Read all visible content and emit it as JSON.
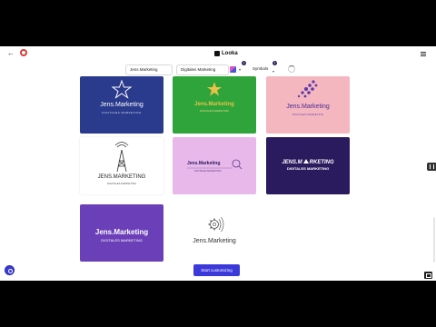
{
  "header": {
    "brand": "Looka",
    "back_icon": "back-arrow-icon",
    "notification_icon": "notification-icon",
    "menu_icon": "menu-icon"
  },
  "filters": {
    "company_name": "Jens.Marketing",
    "industry": "Digitales Marketing",
    "colors_badge": "1",
    "symbols_label": "Symbols",
    "symbols_badge": "1"
  },
  "logos": [
    {
      "name": "Jens.Marketing",
      "tagline": "DIGITALES MARKETING",
      "icon": "star-icon"
    },
    {
      "name": "Jens.Marketing",
      "tagline": "DIGITALES MARKETING",
      "icon": "star-icon"
    },
    {
      "name": "Jens.Marketing",
      "tagline": "DIGITALES MARKETING",
      "icon": "dots-icon"
    },
    {
      "name": "JENS.MARKETING",
      "tagline": "DIGITALES MARKETING",
      "icon": "tower-icon"
    },
    {
      "name": "Jens.Marketing",
      "tagline": "DIGITALES MARKETING",
      "icon": "magnifier-icon"
    },
    {
      "name": "JENS.M",
      "name_end": "RKETING",
      "tagline": "DIGITALES MARKETING",
      "icon": "triangle-icon"
    },
    {
      "name": "Jens.Marketing",
      "tagline": "DIGITALES MARKETING",
      "icon": "none"
    },
    {
      "name": "Jens.Marketing",
      "tagline": "",
      "icon": "gear-icon"
    }
  ],
  "actions": {
    "start_customizing": "Start customizing"
  },
  "colors": {
    "accent": "#3b3ad9",
    "card1": "#2a3a8c",
    "card2": "#2ea43a",
    "card3": "#f4b7c0",
    "card5": "#e8b8ea",
    "card6": "#2a1a5e",
    "card7": "#6b3fb8"
  }
}
